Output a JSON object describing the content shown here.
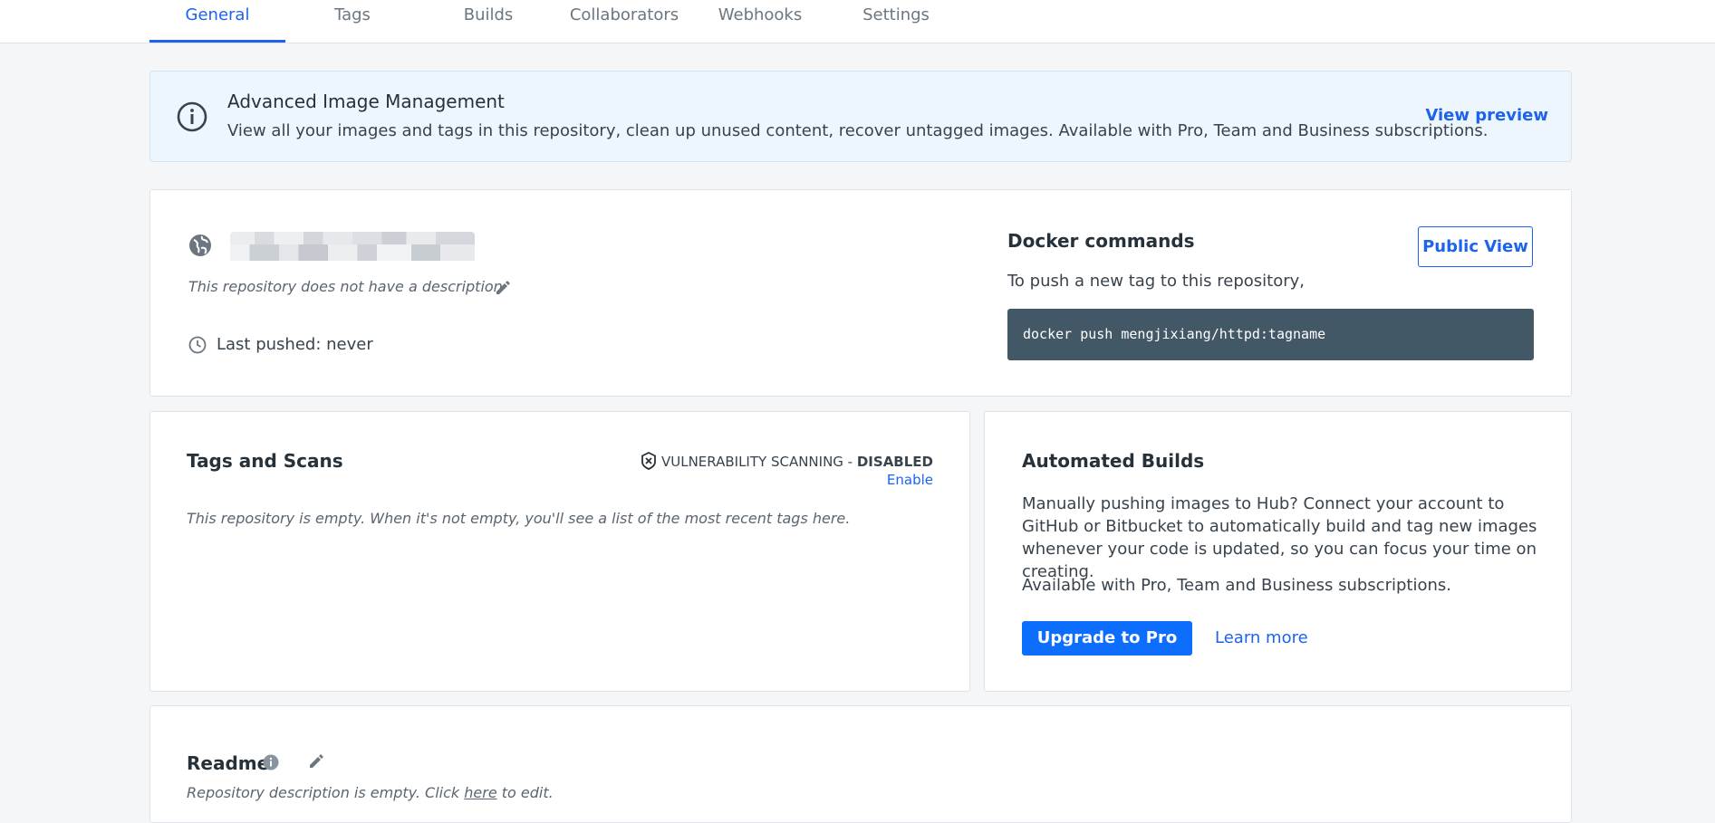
{
  "tabs": [
    {
      "label": "General",
      "active": true
    },
    {
      "label": "Tags"
    },
    {
      "label": "Builds"
    },
    {
      "label": "Collaborators"
    },
    {
      "label": "Webhooks"
    },
    {
      "label": "Settings"
    }
  ],
  "banner": {
    "title": "Advanced Image Management",
    "text": "View all your images and tags in this repository, clean up unused content, recover untagged images. Available with Pro, Team and Business subscriptions.",
    "link": "View preview"
  },
  "repo": {
    "description": "This repository does not have a description",
    "last_pushed": "Last pushed: never"
  },
  "docker": {
    "title": "Docker commands",
    "public_view": "Public View",
    "push_text": "To push a new tag to this repository,",
    "command": "docker push mengjixiang/httpd:tagname"
  },
  "tags_scans": {
    "title": "Tags and Scans",
    "vuln_label": "VULNERABILITY SCANNING - ",
    "vuln_status": "DISABLED",
    "enable": "Enable",
    "empty_text": "This repository is empty. When it's not empty, you'll see a list of the most recent tags here."
  },
  "builds": {
    "title": "Automated Builds",
    "text": "Manually pushing images to Hub? Connect your account to GitHub or Bitbucket to automatically build and tag new images whenever your code is updated, so you can focus your time on creating.",
    "subscriptions": "Available with Pro, Team and Business subscriptions.",
    "upgrade": "Upgrade to Pro",
    "learn_more": "Learn more"
  },
  "readme": {
    "title": "Readme",
    "empty_prefix": "Repository description is empty. Click ",
    "here": "here",
    "empty_suffix": " to edit."
  },
  "colors": {
    "accent": "#1d63ed",
    "primary_button": "#0d6efd",
    "code_bg": "#435867",
    "banner_bg": "#eef6fd"
  }
}
